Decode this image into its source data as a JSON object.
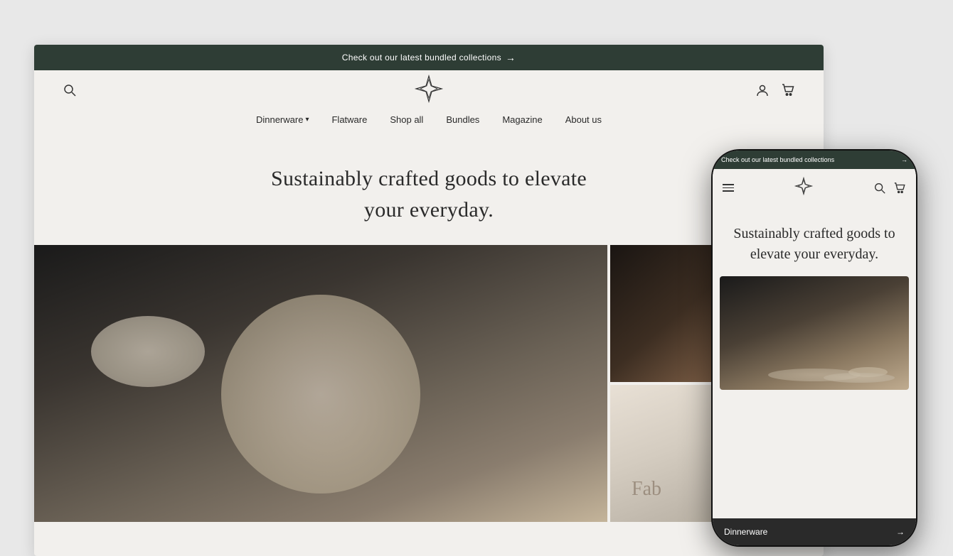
{
  "desktop": {
    "announcement": {
      "text": "Check out our latest bundled collections",
      "arrow": "→"
    },
    "header": {
      "logo_alt": "Brand logo star",
      "search_icon": "search",
      "account_icon": "account",
      "cart_icon": "cart"
    },
    "nav": {
      "items": [
        {
          "label": "Dinnerware",
          "has_dropdown": true
        },
        {
          "label": "Flatware",
          "has_dropdown": false
        },
        {
          "label": "Shop all",
          "has_dropdown": false
        },
        {
          "label": "Bundles",
          "has_dropdown": false
        },
        {
          "label": "Magazine",
          "has_dropdown": false
        },
        {
          "label": "About us",
          "has_dropdown": false
        }
      ]
    },
    "hero": {
      "line1": "Sustainably crafted goods to elevate",
      "line2": "your everyday."
    }
  },
  "phone": {
    "announcement": {
      "text": "Check out our latest bundled collections",
      "arrow": "→"
    },
    "hero": {
      "text": "Sustainably crafted goods to elevate your everyday."
    },
    "bottom_bar": {
      "label": "Dinnerware",
      "arrow": "→"
    }
  }
}
